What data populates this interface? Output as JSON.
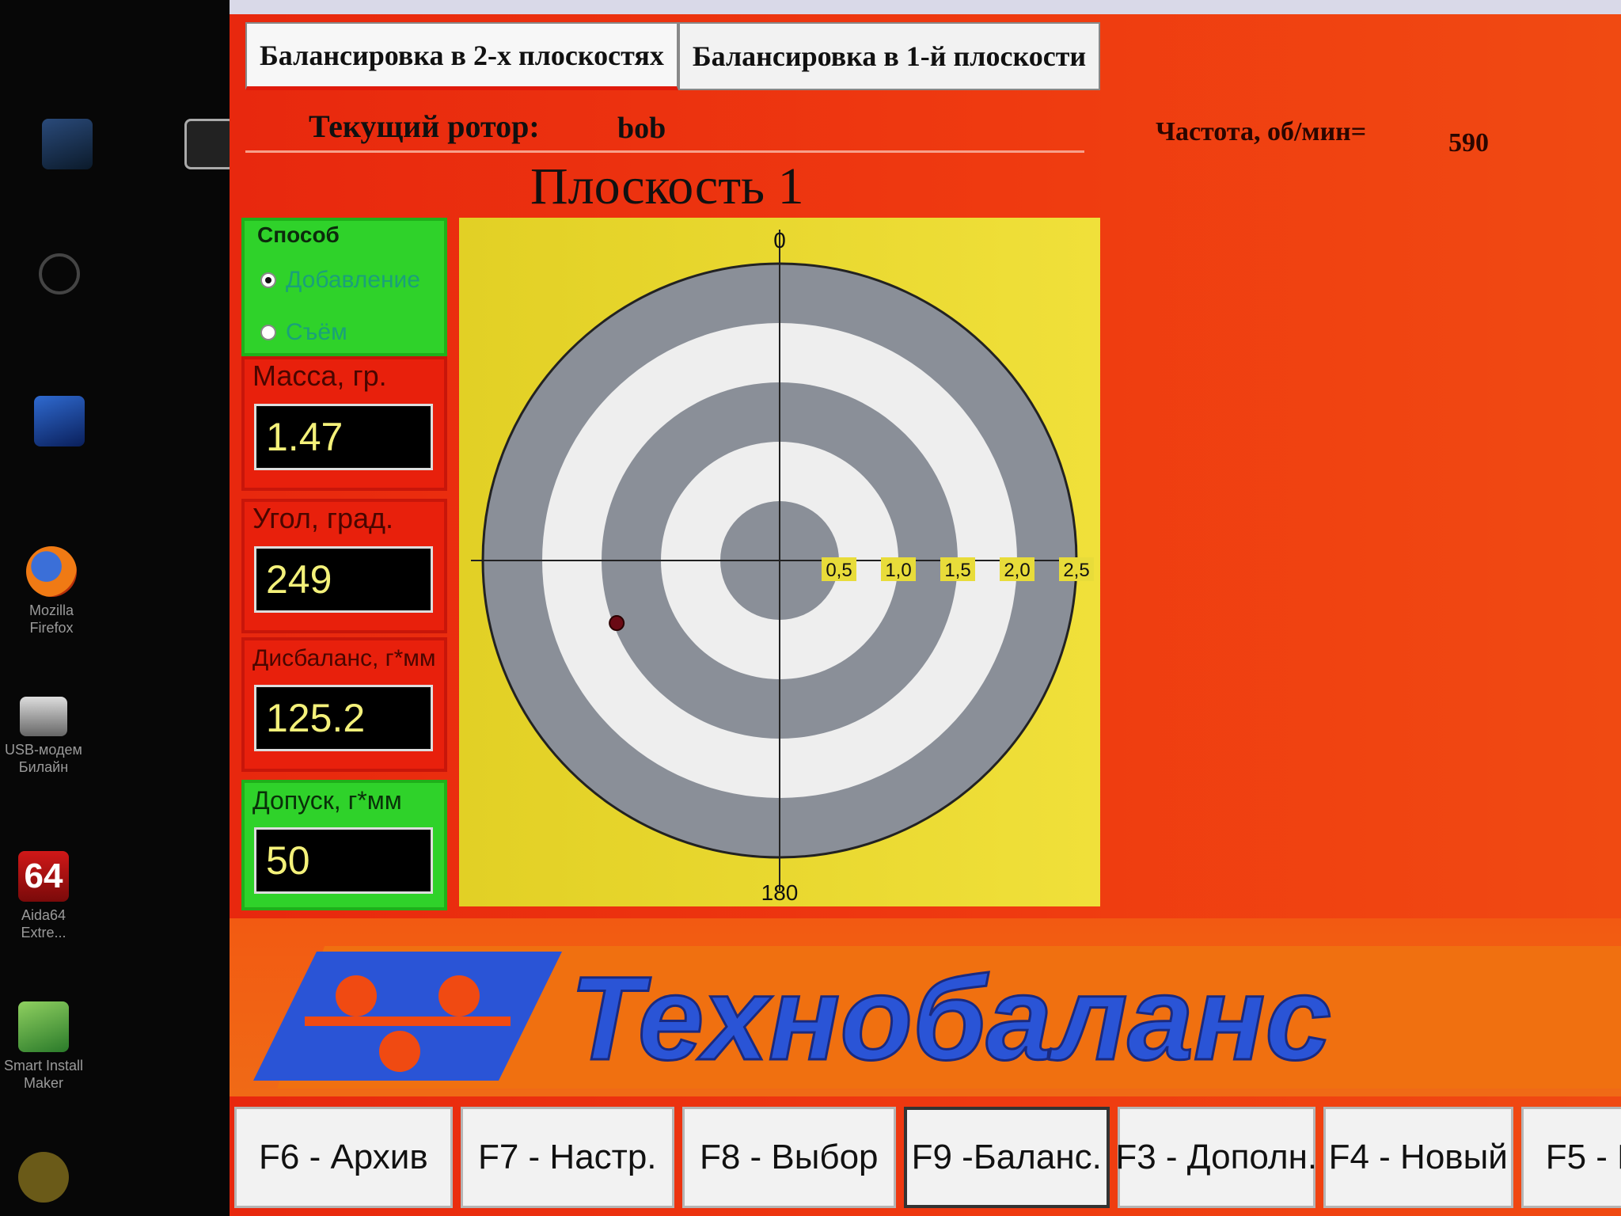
{
  "desktop": {
    "icons": [
      {
        "name": "computer",
        "caption": ""
      },
      {
        "name": "video-file",
        "caption": ""
      },
      {
        "name": "power",
        "caption": ""
      },
      {
        "name": "network",
        "caption": ""
      },
      {
        "name": "firefox",
        "caption": "Mozilla Firefox"
      },
      {
        "name": "usb-modem",
        "caption": "USB-модем\nБилайн"
      },
      {
        "name": "aida64",
        "caption": "Aida64\nExtre..."
      },
      {
        "name": "install-maker",
        "caption": "Smart Install\nMaker"
      },
      {
        "name": "bat",
        "caption": ""
      }
    ],
    "aida_badge": "64"
  },
  "window": {
    "tabs": [
      {
        "label": "Балансировка в 2-х плоскостях",
        "active": true
      },
      {
        "label": "Балансировка в 1-й плоскости",
        "active": false
      }
    ],
    "rotor_label": "Текущий ротор:",
    "rotor_value": "bob",
    "freq_label": "Частота, об/мин=",
    "freq_value": "590",
    "plane_title": "Плоскость 1"
  },
  "panel": {
    "method_label": "Способ",
    "option_add": "Добавление",
    "option_remove": "Съём",
    "selected": "add",
    "mass_label": "Масса, гр.",
    "mass_value": "1.47",
    "angle_label": "Угол, град.",
    "angle_value": "249",
    "unbalance_label": "Дисбаланс, г*мм",
    "unbalance_value": "125.2",
    "tolerance_label": "Допуск, г*мм",
    "tolerance_value": "50"
  },
  "plot": {
    "top_label": "0",
    "bottom_label": "180",
    "ticks": [
      "0,5",
      "1,0",
      "1,5",
      "2,0",
      "2,5"
    ],
    "max_radius": 2.5,
    "marker": {
      "radius": 1.47,
      "angle_deg": 249
    },
    "colors": {
      "dark_ring": "#8a8f98",
      "light_ring": "#eeeeee",
      "marker": "#6a0a14",
      "background": "#e6d82a"
    }
  },
  "banner": {
    "text": "Технобаланс"
  },
  "fkeys": [
    {
      "label": "F6 - Архив",
      "active": false
    },
    {
      "label": "F7 - Настр.",
      "active": false
    },
    {
      "label": "F8 - Выбор",
      "active": false
    },
    {
      "label": "F9 -Баланс.",
      "active": true
    },
    {
      "label": "F3 - Дополн.",
      "active": false
    },
    {
      "label": "F4 - Новый",
      "active": false
    },
    {
      "label": "F5 - Г",
      "active": false
    }
  ]
}
